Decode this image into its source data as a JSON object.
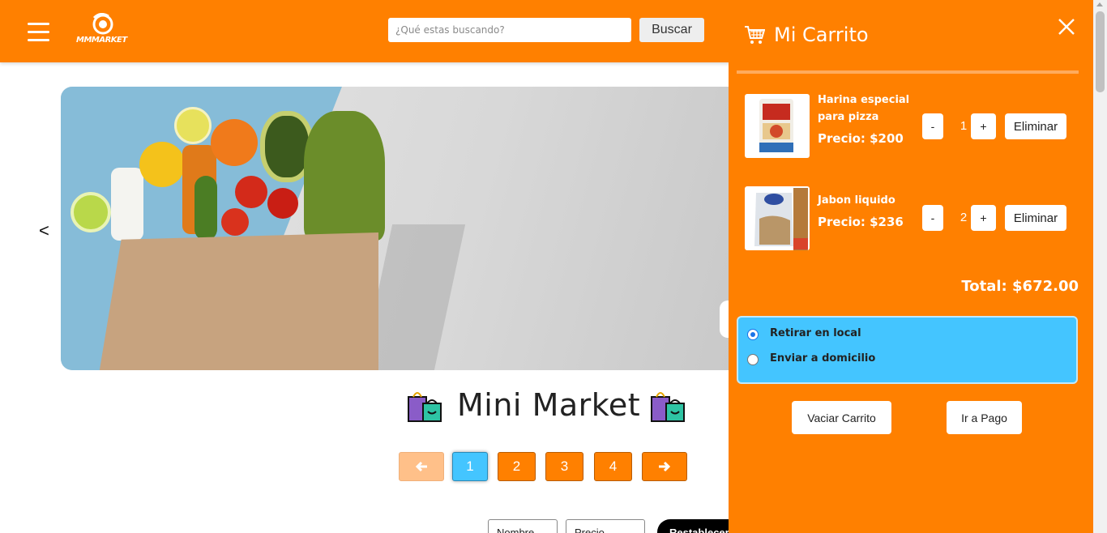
{
  "header": {
    "logo_text": "MMMARKET",
    "search_placeholder": "¿Qué estas buscando?",
    "search_label": "Buscar"
  },
  "hero": {
    "prev_label": "<"
  },
  "main": {
    "title": "Mini Market",
    "pagination": [
      "1",
      "2",
      "3",
      "4"
    ],
    "filters": {
      "name_select": "Nombre",
      "price_select": "Precio",
      "reset_label": "Restablecer"
    }
  },
  "cart": {
    "title": "Mi Carrito",
    "items": [
      {
        "name": "Harina especial para pizza",
        "price": "Precio: $200",
        "qty": "1",
        "minus": "-",
        "plus": "+",
        "remove": "Eliminar"
      },
      {
        "name": "Jabon liquido",
        "price": "Precio: $236",
        "qty": "2",
        "minus": "-",
        "plus": "+",
        "remove": "Eliminar"
      }
    ],
    "total": "Total: $672.00",
    "delivery_options": [
      "Retirar en local",
      "Enviar a domicilio"
    ],
    "selected_option": "Retirar en local",
    "clear_label": "Vaciar Carrito",
    "pay_label": "Ir a Pago"
  },
  "colors": {
    "brand_orange": "#ff8000",
    "accent_blue": "#44c5ff"
  }
}
